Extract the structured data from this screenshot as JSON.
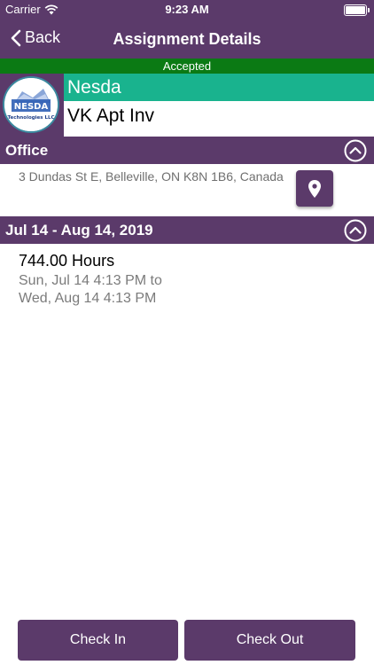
{
  "status_bar": {
    "carrier": "Carrier",
    "time": "9:23 AM"
  },
  "nav": {
    "back_label": "Back",
    "title": "Assignment Details"
  },
  "assignment": {
    "status": "Accepted",
    "company": "Nesda",
    "project": "VK Apt Inv"
  },
  "location": {
    "section_title": "Office",
    "address": "3 Dundas St E, Belleville, ON K8N 1B6, Canada"
  },
  "schedule": {
    "section_title": "Jul 14 - Aug 14, 2019",
    "hours": "744.00 Hours",
    "from": "Sun, Jul 14 4:13 PM to",
    "to": "Wed, Aug 14 4:13 PM"
  },
  "actions": {
    "check_in": "Check In",
    "check_out": "Check Out"
  },
  "colors": {
    "primary": "#5b3a6a",
    "accepted": "#0b7a14",
    "company_bg": "#19b38e"
  },
  "icons": [
    "wifi-icon",
    "battery-icon",
    "chevron-left-icon",
    "chevron-up-circle-icon",
    "map-pin-icon",
    "company-logo"
  ]
}
